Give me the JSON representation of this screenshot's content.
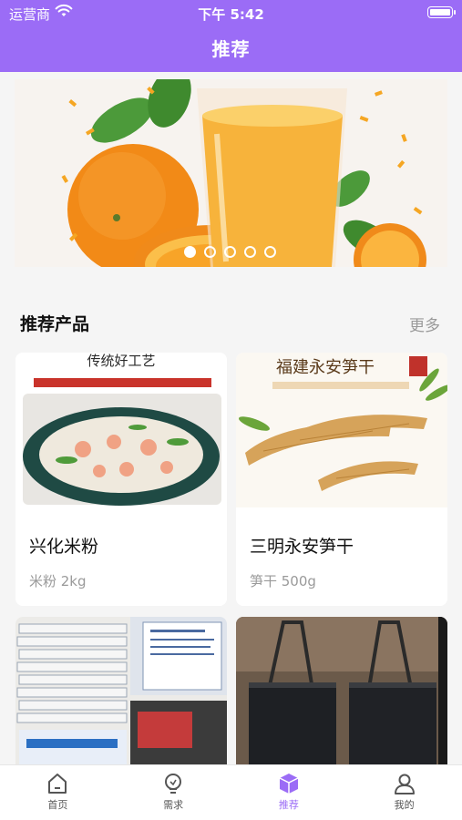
{
  "status_bar": {
    "carrier": "运营商",
    "time": "下午 5:42",
    "wifi_icon": "wifi-icon",
    "battery_icon": "battery-icon"
  },
  "nav": {
    "title": "推荐"
  },
  "banner": {
    "slide_count": 5,
    "active_index": 0
  },
  "section": {
    "title": "推荐产品",
    "more": "更多"
  },
  "products": [
    {
      "name": "兴化米粉",
      "spec": "米粉 2kg",
      "image_text": "传统好工艺"
    },
    {
      "name": "三明永安笋干",
      "spec": "笋干 500g",
      "image_text": "福建永安笋干"
    },
    {
      "name": "",
      "spec": ""
    },
    {
      "name": "",
      "spec": ""
    }
  ],
  "tabbar": {
    "items": [
      {
        "label": "首页",
        "icon": "home-icon"
      },
      {
        "label": "需求",
        "icon": "lightbulb-icon"
      },
      {
        "label": "推荐",
        "icon": "cube-icon",
        "active": true
      },
      {
        "label": "我的",
        "icon": "user-icon"
      }
    ]
  },
  "colors": {
    "accent": "#9b6cf6",
    "muted": "#9a9a9a",
    "background": "#f5f5f5"
  }
}
